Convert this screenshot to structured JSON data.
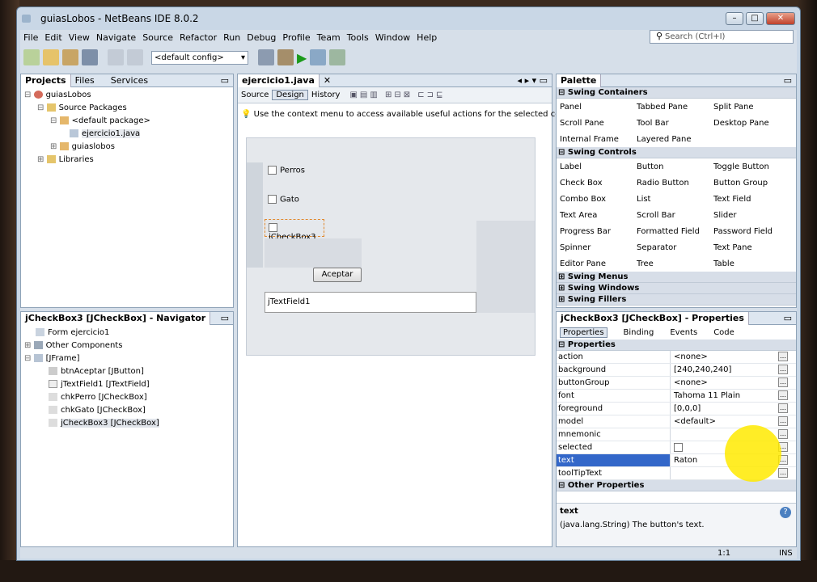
{
  "window": {
    "title": "guiasLobos - NetBeans IDE 8.0.2"
  },
  "menu": [
    "File",
    "Edit",
    "View",
    "Navigate",
    "Source",
    "Refactor",
    "Run",
    "Debug",
    "Profile",
    "Team",
    "Tools",
    "Window",
    "Help"
  ],
  "search": {
    "placeholder": "Search (Ctrl+I)"
  },
  "toolbar": {
    "config": "<default config>"
  },
  "projects": {
    "tabs": [
      "Projects",
      "Files",
      "Services"
    ],
    "tree": [
      "guiasLobos",
      "Source Packages",
      "<default package>",
      "ejercicio1.java",
      "guiaslobos",
      "Libraries"
    ]
  },
  "navigator": {
    "title": "jCheckBox3 [JCheckBox] - Navigator",
    "tree": [
      "Form ejercicio1",
      "Other Components",
      "[JFrame]",
      "btnAceptar [JButton]",
      "jTextField1 [JTextField]",
      "chkPerro [JCheckBox]",
      "chkGato [JCheckBox]",
      "jCheckBox3 [JCheckBox]"
    ]
  },
  "editor": {
    "tab": "ejercicio1.java",
    "views": [
      "Source",
      "Design",
      "History"
    ],
    "hint": "Use the context menu to access available useful actions for the selected components",
    "form": {
      "chk1": "Perros",
      "chk2": "Gato",
      "chk3": "jCheckBox3",
      "button": "Aceptar",
      "textfield": "jTextField1"
    }
  },
  "palette": {
    "title": "Palette",
    "sections": {
      "containers": "Swing Containers",
      "controls": "Swing Controls",
      "menus": "Swing Menus",
      "windows": "Swing Windows",
      "fillers": "Swing Fillers"
    },
    "containers": [
      [
        "Panel",
        "Tabbed Pane",
        "Split Pane"
      ],
      [
        "Scroll Pane",
        "Tool Bar",
        "Desktop Pane"
      ],
      [
        "Internal Frame",
        "Layered Pane",
        ""
      ]
    ],
    "controls": [
      [
        "Label",
        "Button",
        "Toggle Button"
      ],
      [
        "Check Box",
        "Radio Button",
        "Button Group"
      ],
      [
        "Combo Box",
        "List",
        "Text Field"
      ],
      [
        "Text Area",
        "Scroll Bar",
        "Slider"
      ],
      [
        "Progress Bar",
        "Formatted Field",
        "Password Field"
      ],
      [
        "Spinner",
        "Separator",
        "Text Pane"
      ],
      [
        "Editor Pane",
        "Tree",
        "Table"
      ]
    ]
  },
  "properties": {
    "title": "jCheckBox3 [JCheckBox] - Properties",
    "tabs": [
      "Properties",
      "Binding",
      "Events",
      "Code"
    ],
    "section": "Properties",
    "rows": [
      {
        "k": "action",
        "v": "<none>"
      },
      {
        "k": "background",
        "v": "[240,240,240]"
      },
      {
        "k": "buttonGroup",
        "v": "<none>"
      },
      {
        "k": "font",
        "v": "Tahoma 11 Plain"
      },
      {
        "k": "foreground",
        "v": "[0,0,0]"
      },
      {
        "k": "model",
        "v": "<default>"
      },
      {
        "k": "mnemonic",
        "v": ""
      },
      {
        "k": "selected",
        "v": ""
      },
      {
        "k": "text",
        "v": "Raton"
      },
      {
        "k": "toolTipText",
        "v": ""
      }
    ],
    "other": "Other Properties",
    "help_title": "text",
    "help_text": "(java.lang.String) The button's text."
  },
  "status": {
    "position": "1:1",
    "mode": "INS"
  },
  "colors": {
    "accent": "#3367c9",
    "highlight": "#ffea00"
  }
}
